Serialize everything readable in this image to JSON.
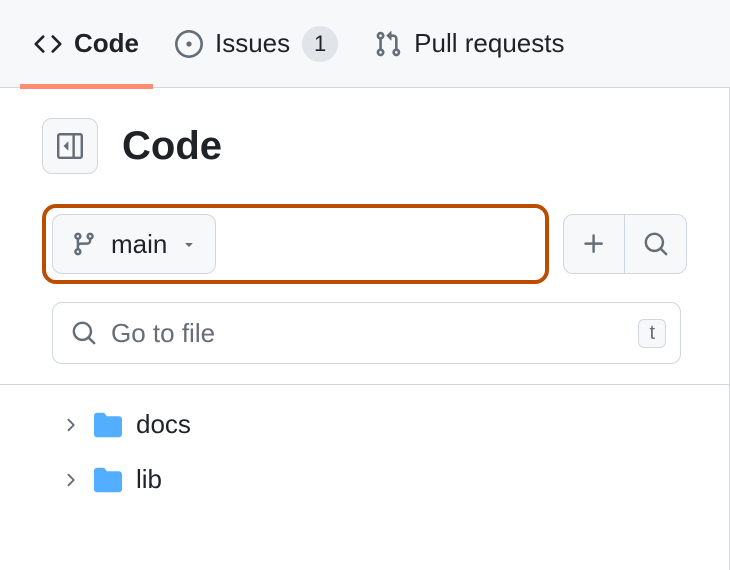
{
  "tabs": {
    "code": "Code",
    "issues": "Issues",
    "issues_count": "1",
    "pulls": "Pull requests"
  },
  "page_title": "Code",
  "branch": {
    "name": "main"
  },
  "search": {
    "placeholder": "Go to file",
    "shortcut": "t"
  },
  "tree": [
    {
      "name": "docs"
    },
    {
      "name": "lib"
    }
  ]
}
